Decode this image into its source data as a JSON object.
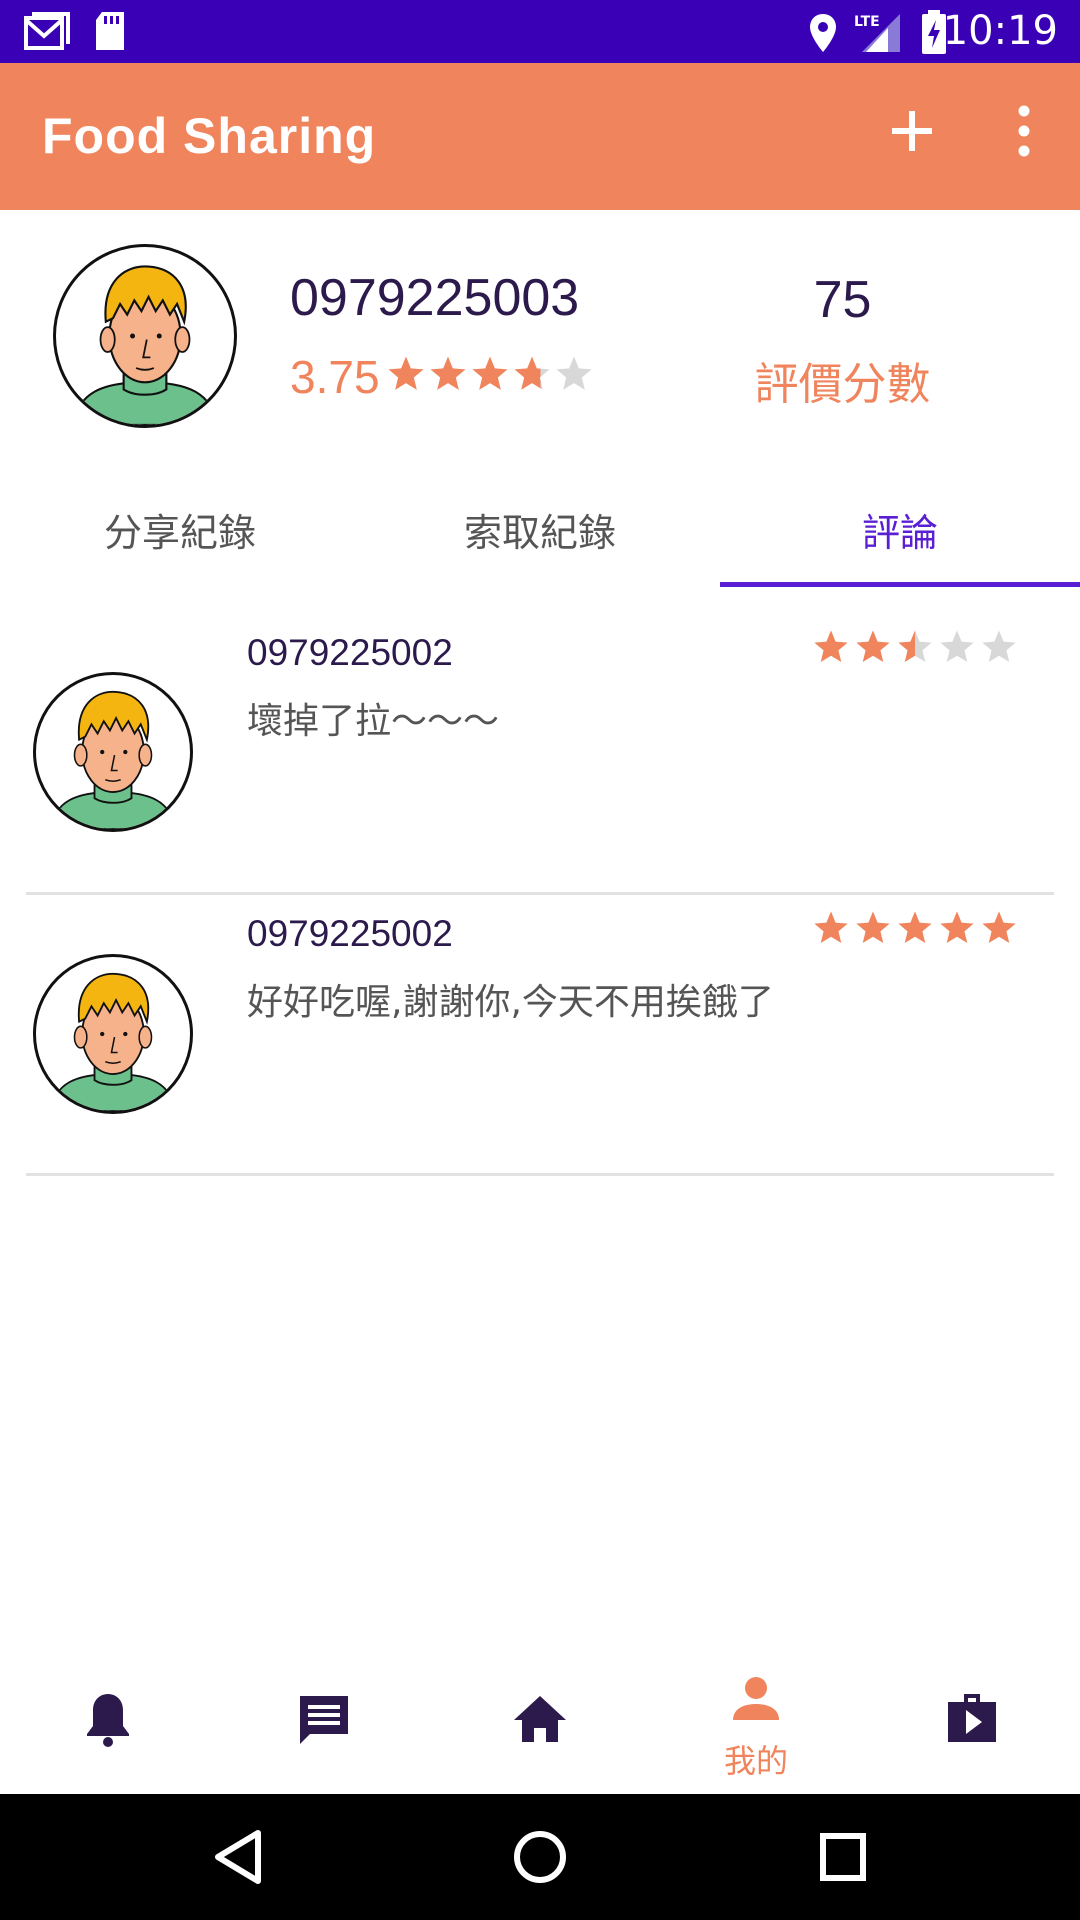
{
  "status_bar": {
    "time": "10:19",
    "icons": [
      "gmail-icon",
      "sd-card-icon",
      "location-icon",
      "lte-signal-icon",
      "battery-charging-icon"
    ],
    "color": "#3a00b5"
  },
  "app_bar": {
    "title": "Food Sharing",
    "add_icon": "plus-icon",
    "more_icon": "more-vert-icon",
    "color": "#f0845c"
  },
  "profile": {
    "phone": "0979225003",
    "rating_value": "3.75",
    "rating_stars": 3.75,
    "score_value": "75",
    "score_label": "評價分數"
  },
  "tabs": [
    {
      "label": "分享紀錄",
      "active": false
    },
    {
      "label": "索取紀錄",
      "active": false
    },
    {
      "label": "評論",
      "active": true
    }
  ],
  "reviews": [
    {
      "name": "0979225002",
      "text": "壞掉了拉～～～",
      "stars": 2.5
    },
    {
      "name": "0979225002",
      "text": "好好吃喔,謝謝你,今天不用挨餓了",
      "stars": 5
    }
  ],
  "bottom_nav": [
    {
      "icon": "bell-icon",
      "label": "",
      "active": false
    },
    {
      "icon": "chat-icon",
      "label": "",
      "active": false
    },
    {
      "icon": "home-icon",
      "label": "",
      "active": false
    },
    {
      "icon": "person-icon",
      "label": "我的",
      "active": true
    },
    {
      "icon": "video-bag-icon",
      "label": "",
      "active": false
    }
  ],
  "colors": {
    "accent": "#f0845c",
    "primary_dark": "#2c1a4d",
    "tab_active": "#5a1fd4",
    "star_empty": "#d8d8d8"
  }
}
